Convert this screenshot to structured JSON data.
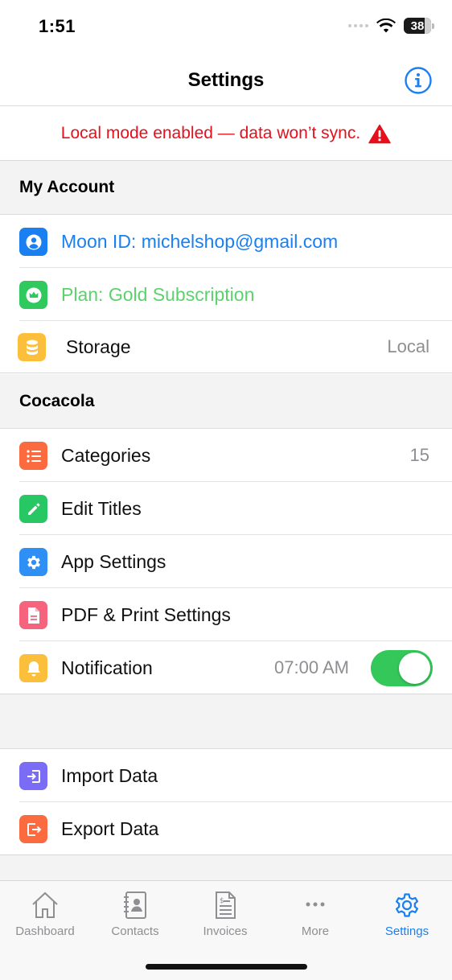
{
  "status_bar": {
    "time": "1:51",
    "battery": "38"
  },
  "nav": {
    "title": "Settings",
    "info_icon": "info-circle-icon"
  },
  "banner": {
    "text": "Local mode enabled — data won’t sync.",
    "icon": "warning-triangle-icon",
    "color": "#e5101c"
  },
  "sections": {
    "my_account": {
      "title": "My Account",
      "items": [
        {
          "label": "Moon ID: michelshop@gmail.com",
          "icon": "person-icon",
          "icon_bg": "#1a7ff0",
          "label_color": "#1a7ff0",
          "value": ""
        },
        {
          "label": "Plan: Gold Subscription",
          "icon": "crown-icon",
          "icon_bg": "#2fc95e",
          "label_color": "#5dd16d",
          "value": ""
        },
        {
          "label": "Storage",
          "icon": "database-icon",
          "icon_bg": "#fbbf3c",
          "label_color": "#111111",
          "value": "Local"
        }
      ]
    },
    "cocacola": {
      "title": "Cocacola",
      "items": [
        {
          "label": "Categories",
          "icon": "list-icon",
          "icon_bg": "#fb6b3f",
          "value": "15"
        },
        {
          "label": "Edit Titles",
          "icon": "pencil-icon",
          "icon_bg": "#27c863",
          "value": ""
        },
        {
          "label": "App Settings",
          "icon": "gear-icon",
          "icon_bg": "#2e8ff5",
          "value": ""
        },
        {
          "label": "PDF & Print Settings",
          "icon": "document-icon",
          "icon_bg": "#f5647c",
          "value": ""
        },
        {
          "label": "Notification",
          "icon": "bell-icon",
          "icon_bg": "#fbbf3c",
          "value": "07:00 AM",
          "toggle_on": true
        }
      ]
    },
    "data": {
      "items": [
        {
          "label": "Import Data",
          "icon": "import-icon",
          "icon_bg": "#7b6cf6",
          "value": ""
        },
        {
          "label": "Export Data",
          "icon": "export-icon",
          "icon_bg": "#fb6b3f",
          "value": ""
        }
      ]
    }
  },
  "tab_bar": {
    "accent": "#1a7ff0",
    "tabs": [
      {
        "label": "Dashboard",
        "icon": "home-icon",
        "active": false
      },
      {
        "label": "Contacts",
        "icon": "contacts-icon",
        "active": false
      },
      {
        "label": "Invoices",
        "icon": "invoice-icon",
        "active": false
      },
      {
        "label": "More",
        "icon": "more-icon",
        "active": false
      },
      {
        "label": "Settings",
        "icon": "gear-icon",
        "active": true
      }
    ]
  }
}
